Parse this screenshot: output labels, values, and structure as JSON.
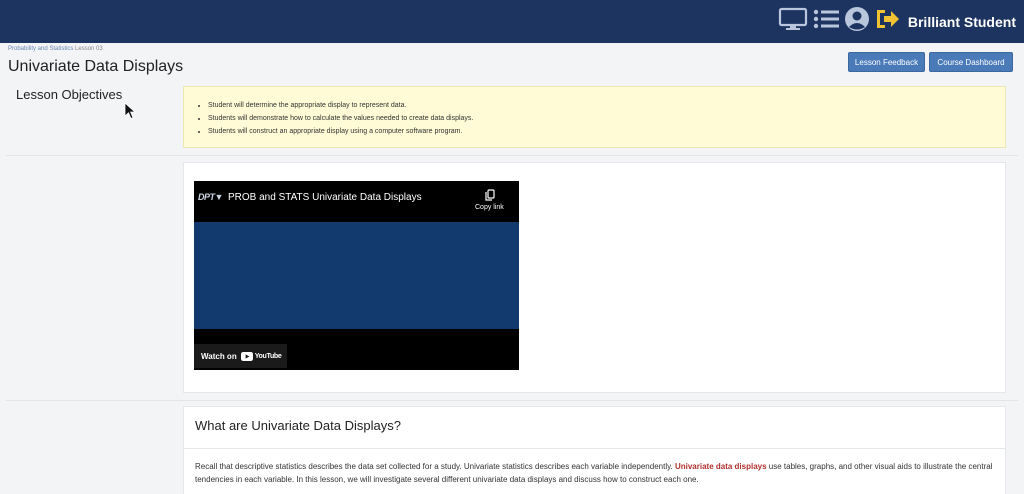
{
  "topbar": {
    "student_name": "Brilliant Student",
    "icons": [
      "monitor-icon",
      "list-icon",
      "account-icon",
      "sign-out-icon"
    ],
    "bg_color": "#1d3461"
  },
  "header": {
    "breadcrumb_course": "Probability and Statistics",
    "breadcrumb_lesson": "Lesson 03",
    "title": "Univariate Data Displays",
    "feedback_label": "Lesson Feedback",
    "dashboard_label": "Course Dashboard"
  },
  "objectives": {
    "heading": "Lesson Objectives",
    "items": [
      "Student will determine the appropriate display to represent data.",
      "Students will demonstrate how to calculate the values needed to create data displays.",
      "Students will construct an appropriate display using a computer software program."
    ],
    "bg_color": "#fffbd6"
  },
  "video": {
    "title": "PROB and STATS Univariate Data Displays",
    "copy_label": "Copy link",
    "watch_label": "Watch on",
    "platform": "YouTube"
  },
  "section": {
    "title": "What are Univariate Data Displays?",
    "body_before": "Recall that descriptive statistics describes the data set collected for a study.  Univariate statistics describes each variable independently. ",
    "body_highlight": "Univariate data displays",
    "body_after": " use tables, graphs, and other visual aids to illustrate the central tendencies in each variable.  In this lesson, we will investigate several different univariate data displays and discuss how to construct each one.",
    "highlight_color": "#b0312d"
  }
}
